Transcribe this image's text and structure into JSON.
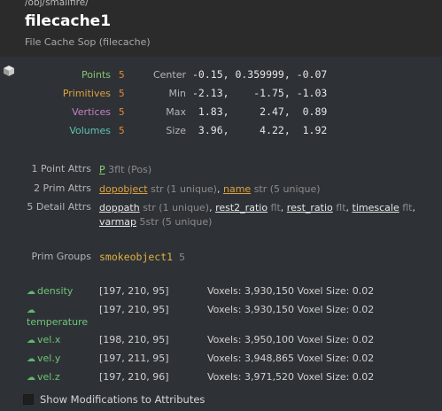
{
  "header": {
    "path": "/obj/smallfire/",
    "title": "filecache1",
    "subtitle": "File Cache Sop (filecache)"
  },
  "stats": [
    {
      "label": "Points",
      "value": "5",
      "color": "#8dc26f"
    },
    {
      "label": "Primitives",
      "value": "5",
      "color": "#e0a03c"
    },
    {
      "label": "Vertices",
      "value": "5",
      "color": "#c97fc4"
    },
    {
      "label": "Volumes",
      "value": "5",
      "color": "#5ec2b0"
    }
  ],
  "bbox": [
    {
      "label": "Center",
      "value": "-0.15, 0.359999, -0.07"
    },
    {
      "label": "Min",
      "value": "-2.13,    -1.75, -1.03"
    },
    {
      "label": "Max",
      "value": " 1.83,     2.47,  0.89"
    },
    {
      "label": "Size",
      "value": " 3.96,     4.22,  1.92"
    }
  ],
  "attributes": {
    "point": {
      "label": "1 Point Attrs",
      "items": [
        {
          "name": "P",
          "type": "3flt",
          "note": "(Pos)"
        }
      ]
    },
    "prim": {
      "label": "2 Prim Attrs",
      "items": [
        {
          "name": "dopobject",
          "type": "str",
          "note": "(1 unique)"
        },
        {
          "name": "name",
          "type": "str",
          "note": "(5 unique)"
        }
      ]
    },
    "detail": {
      "label": "5 Detail Attrs",
      "items": [
        {
          "name": "doppath",
          "type": "str",
          "note": "(1 unique)"
        },
        {
          "name": "rest2_ratio",
          "type": "flt"
        },
        {
          "name": "rest_ratio",
          "type": "flt"
        },
        {
          "name": "timescale",
          "type": "flt"
        },
        {
          "name": "varmap",
          "type": "5str",
          "note": "(5 unique)"
        }
      ]
    }
  },
  "groups": {
    "label": "Prim Groups",
    "name": "smokeobject1",
    "count": "5"
  },
  "volumes": [
    {
      "name": "density",
      "res": "[197, 210, 95]",
      "voxels": "Voxels: 3,930,150 Voxel Size: 0.02"
    },
    {
      "name": "temperature",
      "res": "[197, 210, 95]",
      "voxels": "Voxels: 3,930,150 Voxel Size: 0.02"
    },
    {
      "name": "vel.x",
      "res": "[198, 210, 95]",
      "voxels": "Voxels: 3,950,100 Voxel Size: 0.02"
    },
    {
      "name": "vel.y",
      "res": "[197, 211, 95]",
      "voxels": "Voxels: 3,948,865 Voxel Size: 0.02"
    },
    {
      "name": "vel.z",
      "res": "[197, 210, 96]",
      "voxels": "Voxels: 3,971,520 Voxel Size: 0.02"
    }
  ],
  "footer": {
    "checkbox_label": "Show Modifications to Attributes",
    "checked": false
  },
  "icons": {
    "volume": "cloud-icon",
    "geometry": "cube-icon"
  }
}
